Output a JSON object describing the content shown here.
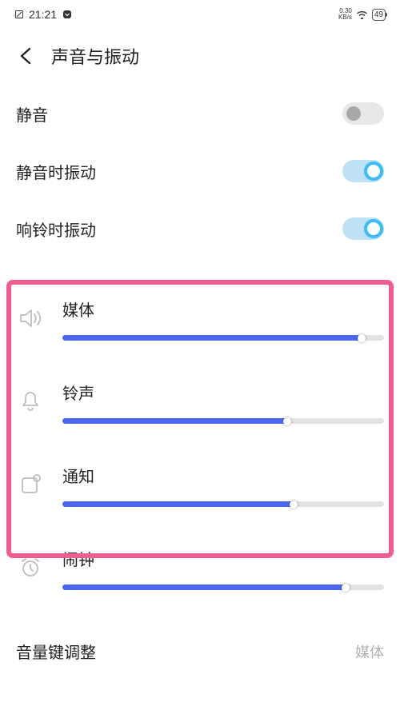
{
  "status": {
    "time": "21:21",
    "net_speed_top": "0.30",
    "net_speed_bottom": "KB/s",
    "battery": "49"
  },
  "header": {
    "title": "声音与振动"
  },
  "toggles": {
    "mute": {
      "label": "静音",
      "on": false
    },
    "vibrate_on_mute": {
      "label": "静音时振动",
      "on": true
    },
    "vibrate_on_ring": {
      "label": "响铃时振动",
      "on": true
    }
  },
  "sliders": {
    "media": {
      "label": "媒体",
      "value": 93
    },
    "ringtone": {
      "label": "铃声",
      "value": 70
    },
    "notification": {
      "label": "通知",
      "value": 72
    },
    "alarm": {
      "label": "闹钟",
      "value": 88
    }
  },
  "footer": {
    "volume_key_label": "音量键调整",
    "volume_key_value": "媒体"
  }
}
